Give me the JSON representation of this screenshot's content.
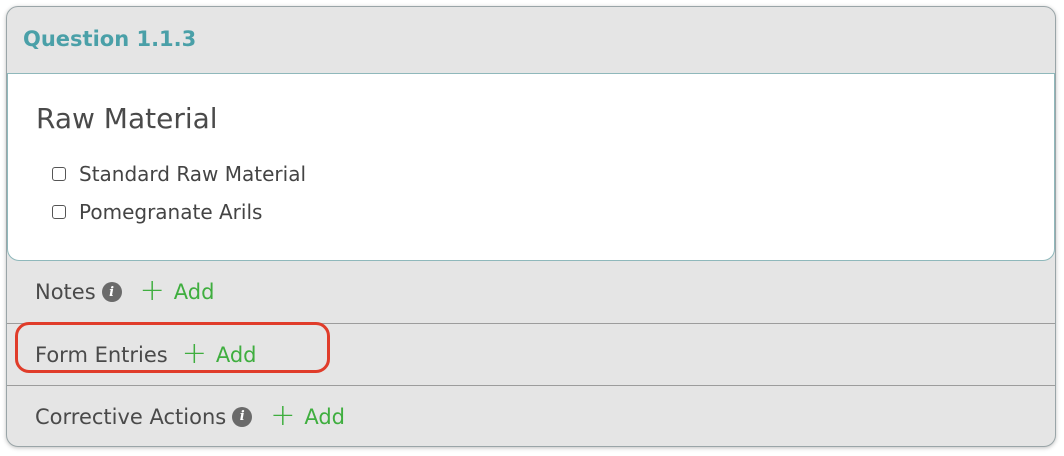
{
  "question": {
    "number_label": "Question 1.1.3",
    "heading": "Raw Material",
    "options": [
      {
        "label": "Standard Raw Material",
        "checked": false
      },
      {
        "label": "Pomegranate Arils",
        "checked": false
      }
    ]
  },
  "sections": {
    "notes": {
      "label": "Notes",
      "has_info": true,
      "add_label": "Add",
      "add_symbol": "+"
    },
    "form_entries": {
      "label": "Form Entries",
      "has_info": false,
      "add_label": "Add",
      "add_symbol": "+"
    },
    "corrective_actions": {
      "label": "Corrective Actions",
      "has_info": true,
      "add_label": "Add",
      "add_symbol": "+"
    }
  },
  "info_glyph": "i",
  "colors": {
    "accent_teal": "#4aa0a8",
    "add_green": "#3fae3f",
    "highlight_red": "#e03c2a"
  },
  "icons": {
    "info": "info-icon",
    "plus": "plus-icon",
    "checkbox": "checkbox-icon"
  }
}
